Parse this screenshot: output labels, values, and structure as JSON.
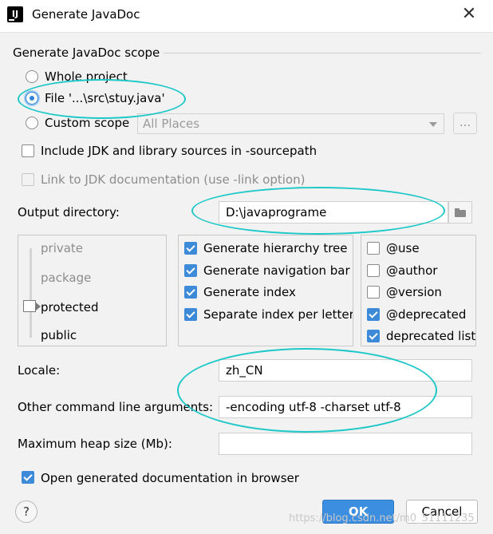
{
  "window": {
    "title": "Generate JavaDoc",
    "app_icon": "IJ"
  },
  "scope": {
    "title": "Generate JavaDoc scope",
    "options": [
      {
        "label": "Whole project",
        "checked": false
      },
      {
        "label": "File '...\\src\\stuy.java'",
        "checked": true
      },
      {
        "label": "Custom scope",
        "checked": false
      }
    ],
    "custom_scope_value": "All Places",
    "browse_label": "..."
  },
  "include_jdk": {
    "label": "Include JDK and library sources in -sourcepath",
    "checked": false
  },
  "link_jdk": {
    "label": "Link to JDK documentation (use -link option)",
    "checked": false,
    "disabled": true
  },
  "output_directory": {
    "label": "Output directory:",
    "value": "D:\\javaprograme"
  },
  "visibility": {
    "levels": [
      "private",
      "package",
      "protected",
      "public"
    ],
    "selected": "protected"
  },
  "generate_options": [
    {
      "label": "Generate hierarchy tree",
      "checked": true
    },
    {
      "label": "Generate navigation bar",
      "checked": true
    },
    {
      "label": "Generate index",
      "checked": true
    },
    {
      "label": "Separate index per letter",
      "checked": true
    }
  ],
  "tag_options": [
    {
      "label": "@use",
      "checked": false
    },
    {
      "label": "@author",
      "checked": false
    },
    {
      "label": "@version",
      "checked": false
    },
    {
      "label": "@deprecated",
      "checked": true
    },
    {
      "label": "deprecated list",
      "checked": true
    }
  ],
  "locale": {
    "label": "Locale:",
    "value": "zh_CN"
  },
  "other_args": {
    "label": "Other command line arguments:",
    "value": "-encoding utf-8 -charset utf-8"
  },
  "heap_size": {
    "label": "Maximum heap size (Mb):",
    "value": ""
  },
  "open_browser": {
    "label": "Open generated documentation in browser",
    "checked": true
  },
  "buttons": {
    "help": "?",
    "ok": "OK",
    "cancel": "Cancel"
  },
  "watermark": "https://blog.csdn.net/m0_51111235",
  "colors": {
    "accent": "#3c8ad8",
    "annotation": "#1fc8c8",
    "background": "#f2f2f2"
  }
}
